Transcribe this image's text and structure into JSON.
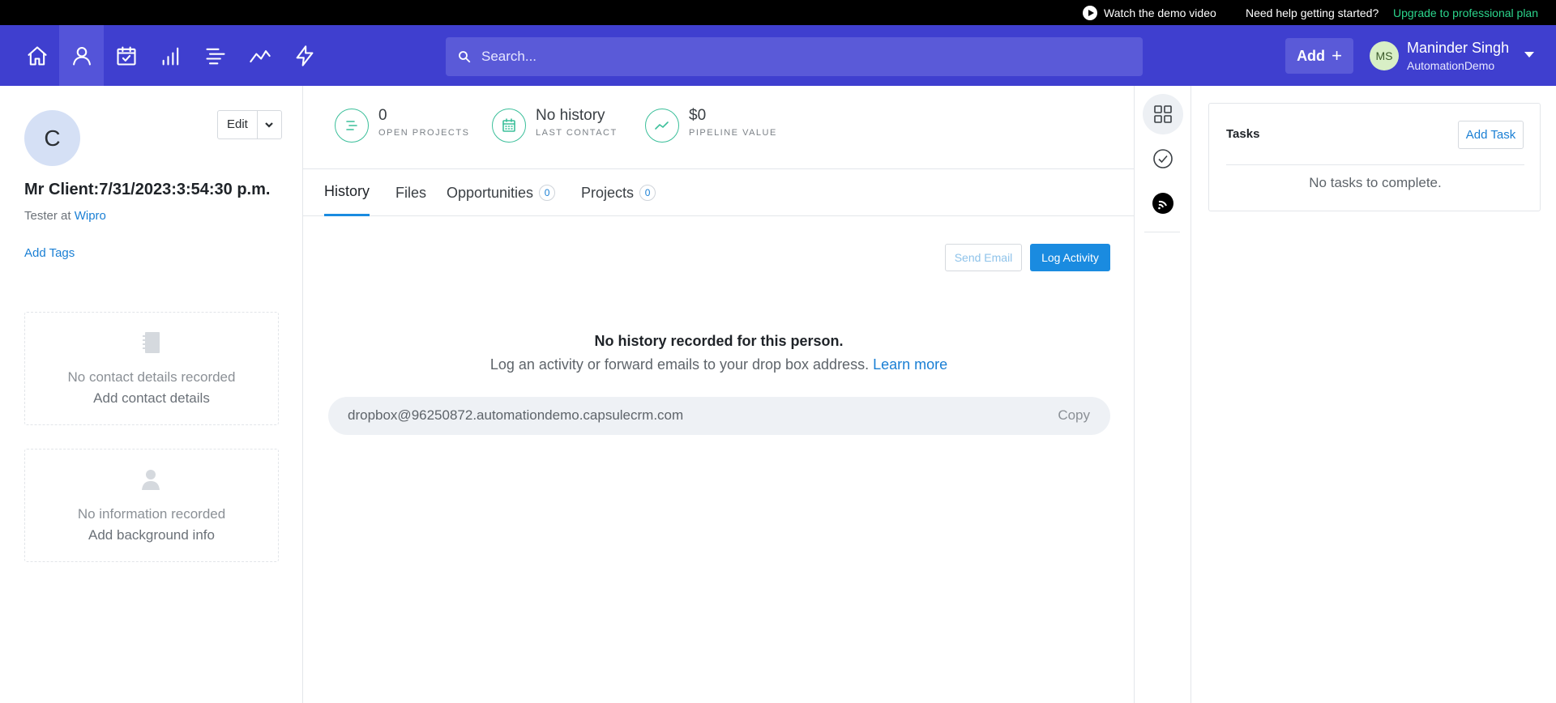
{
  "topbar": {
    "demo_label": "Watch the demo video",
    "help_label": "Need help getting started?",
    "upgrade_label": "Upgrade to professional plan"
  },
  "nav": {
    "icons": [
      "home-icon",
      "person-icon",
      "calendar-check-icon",
      "bar-chart-icon",
      "projects-icon",
      "trend-icon",
      "lightning-icon"
    ],
    "search_placeholder": "Search...",
    "add_label": "Add",
    "user": {
      "initials": "MS",
      "name": "Maninder Singh",
      "org": "AutomationDemo"
    }
  },
  "contact": {
    "initial": "C",
    "edit_label": "Edit",
    "name": "Mr Client:7/31/2023:3:54:30 p.m.",
    "role_prefix": "Tester at",
    "company": "Wipro",
    "add_tags": "Add Tags",
    "details_empty": "No contact details recorded",
    "details_add": "Add contact details",
    "background_empty": "No information recorded",
    "background_add": "Add background info"
  },
  "stats": [
    {
      "value": "0",
      "label": "OPEN PROJECTS"
    },
    {
      "value": "No history",
      "label": "LAST CONTACT"
    },
    {
      "value": "$0",
      "label": "PIPELINE VALUE"
    }
  ],
  "tabs": [
    {
      "label": "History"
    },
    {
      "label": "Files"
    },
    {
      "label": "Opportunities",
      "count": "0"
    },
    {
      "label": "Projects",
      "count": "0"
    }
  ],
  "history": {
    "send_email": "Send Email",
    "log_activity": "Log Activity",
    "empty_title": "No history recorded for this person.",
    "empty_sub": "Log an activity or forward emails to your drop box address.",
    "learn_more": "Learn more",
    "dropbox": "dropbox@96250872.automationdemo.capsulecrm.com",
    "copy": "Copy"
  },
  "tasks": {
    "title": "Tasks",
    "add_task": "Add Task",
    "empty": "No tasks to complete."
  },
  "colors": {
    "nav_bg": "#3f3fcf",
    "accent": "#1a8be0",
    "stat_green": "#3bbf9a",
    "upgrade_green": "#2bd58c"
  }
}
